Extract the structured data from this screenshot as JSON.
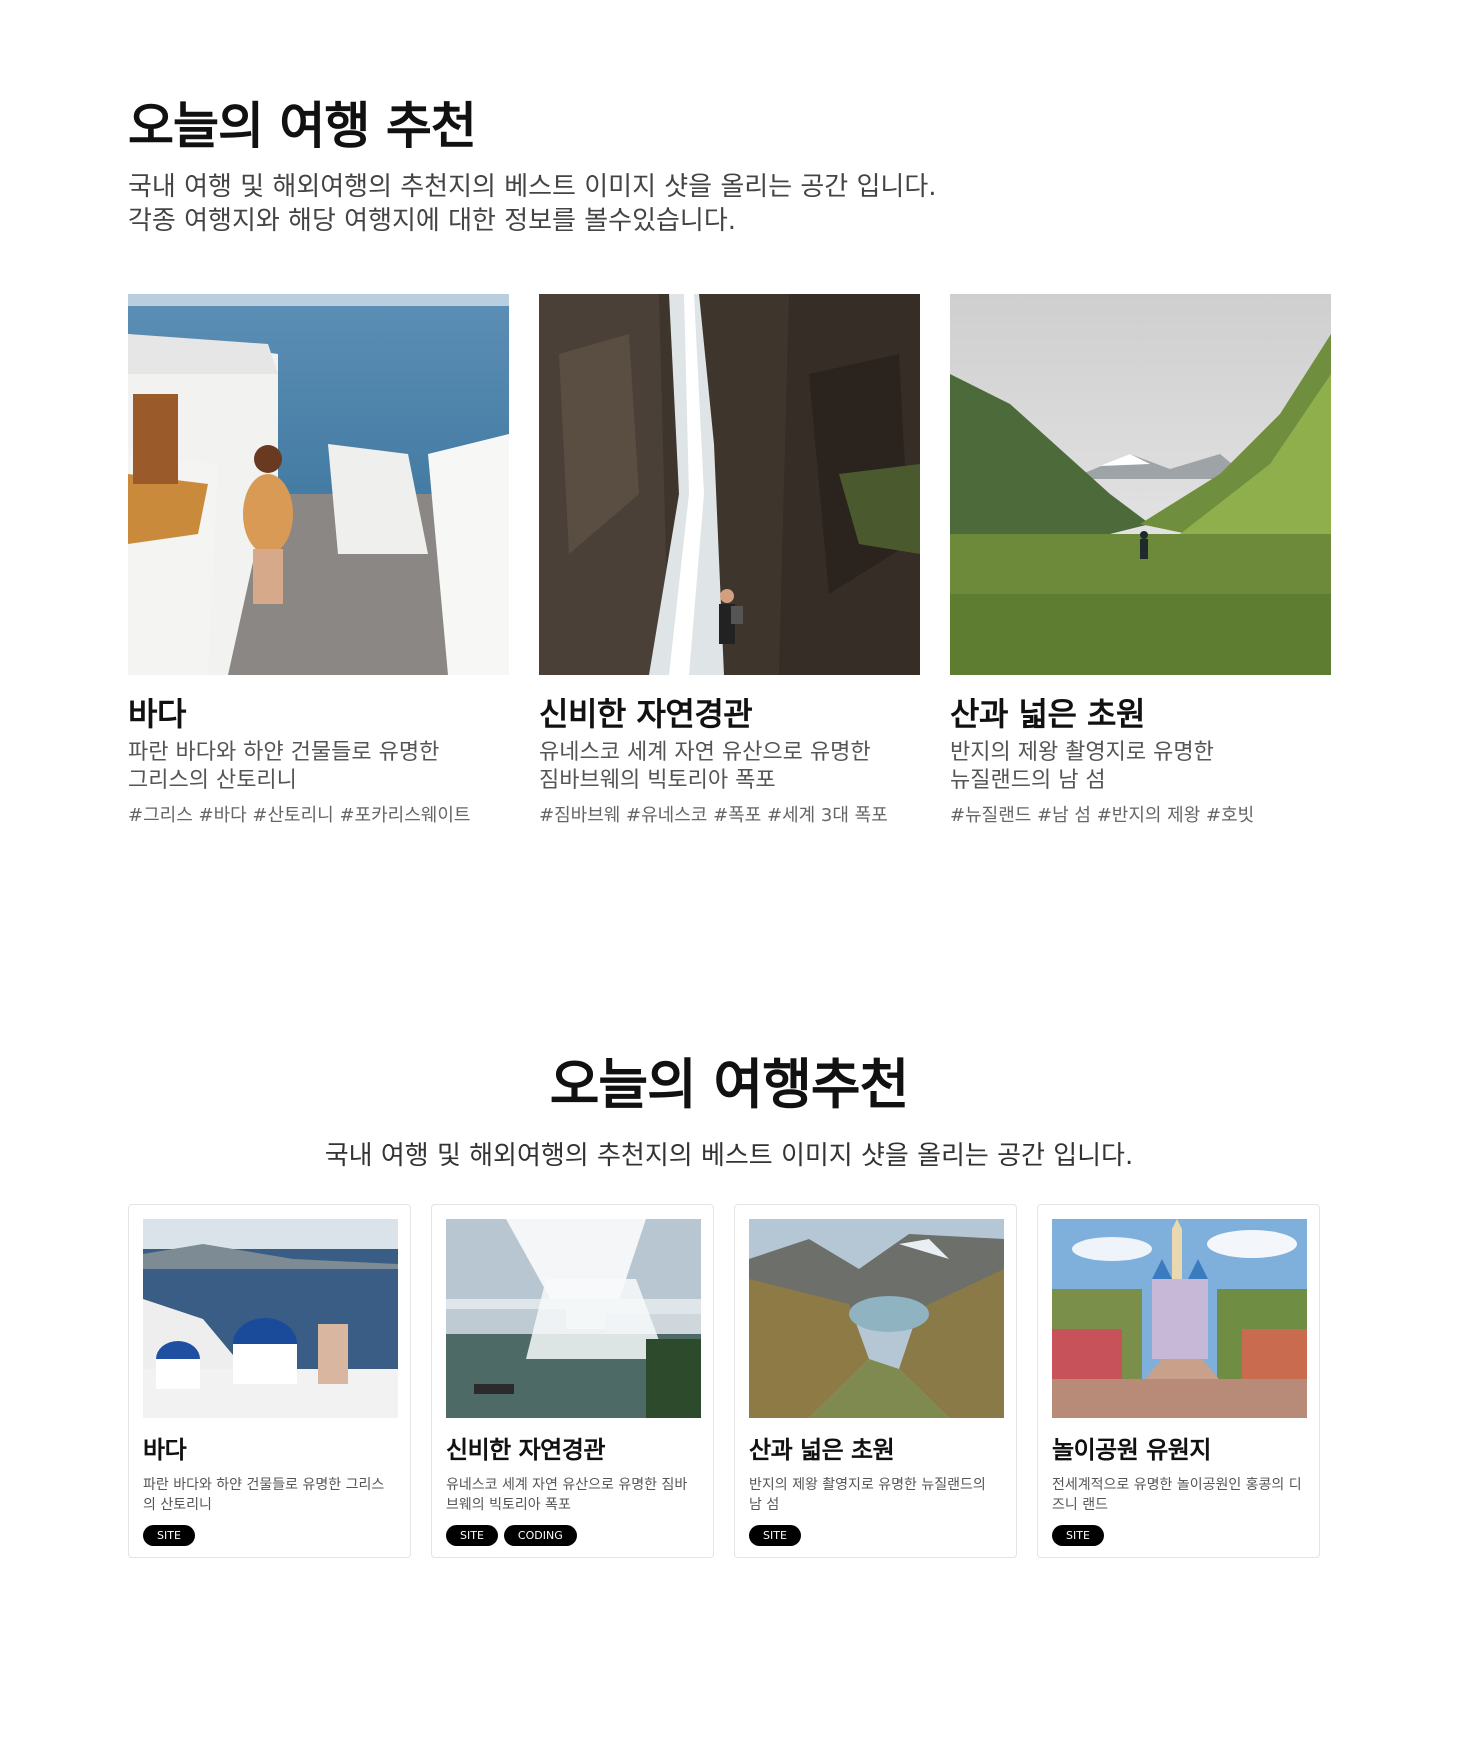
{
  "section1": {
    "title": "오늘의 여행 추천",
    "desc_line1": "국내 여행 및 해외여행의 추천지의 베스트 이미지 샷을 올리는 공간 입니다.",
    "desc_line2": "각종 여행지와 해당 여행지에 대한 정보를 볼수있습니다.",
    "cards": [
      {
        "image": "santorini-stairs-photo",
        "title": "바다",
        "desc_line1": "파란 바다와 하얀 건물들로 유명한",
        "desc_line2": "그리스의 산토리니",
        "tags": "#그리스 #바다 #산토리니 #포카리스웨이트"
      },
      {
        "image": "waterfall-photo",
        "title": "신비한 자연경관",
        "desc_line1": "유네스코 세계 자연 유산으로 유명한",
        "desc_line2": "짐바브웨의 빅토리아 폭포",
        "tags": "#짐바브웨 #유네스코 #폭포 #세계 3대 폭포"
      },
      {
        "image": "mountain-valley-photo",
        "title": "산과 넓은 초원",
        "desc_line1": "반지의 제왕 촬영지로 유명한",
        "desc_line2": "뉴질랜드의 남 섬",
        "tags": "#뉴질랜드 #남 섬 #반지의 제왕 #호빗"
      }
    ]
  },
  "section2": {
    "title": "오늘의 여행추천",
    "desc": "국내 여행 및 해외여행의 추천지의 베스트 이미지 샷을 올리는 공간 입니다.",
    "cards": [
      {
        "image": "santorini-domes-photo",
        "title": "바다",
        "desc": "파란 바다와 하얀 건물들로 유명한 그리스의 산토리니",
        "badges": [
          "SITE"
        ]
      },
      {
        "image": "niagara-falls-photo",
        "title": "신비한 자연경관",
        "desc": "유네스코 세계 자연 유산으로 유명한 짐바브웨의 빅토리아 폭포",
        "badges": [
          "SITE",
          "CODING"
        ]
      },
      {
        "image": "mountain-lake-photo",
        "title": "산과 넓은 초원",
        "desc": "반지의 제왕 촬영지로 유명한 뉴질랜드의 남 섬",
        "badges": [
          "SITE"
        ]
      },
      {
        "image": "theme-park-castle-photo",
        "title": "놀이공원 유원지",
        "desc": "전세계적으로 유명한 놀이공원인 홍콩의 디즈니 랜드",
        "badges": [
          "SITE"
        ]
      }
    ]
  }
}
